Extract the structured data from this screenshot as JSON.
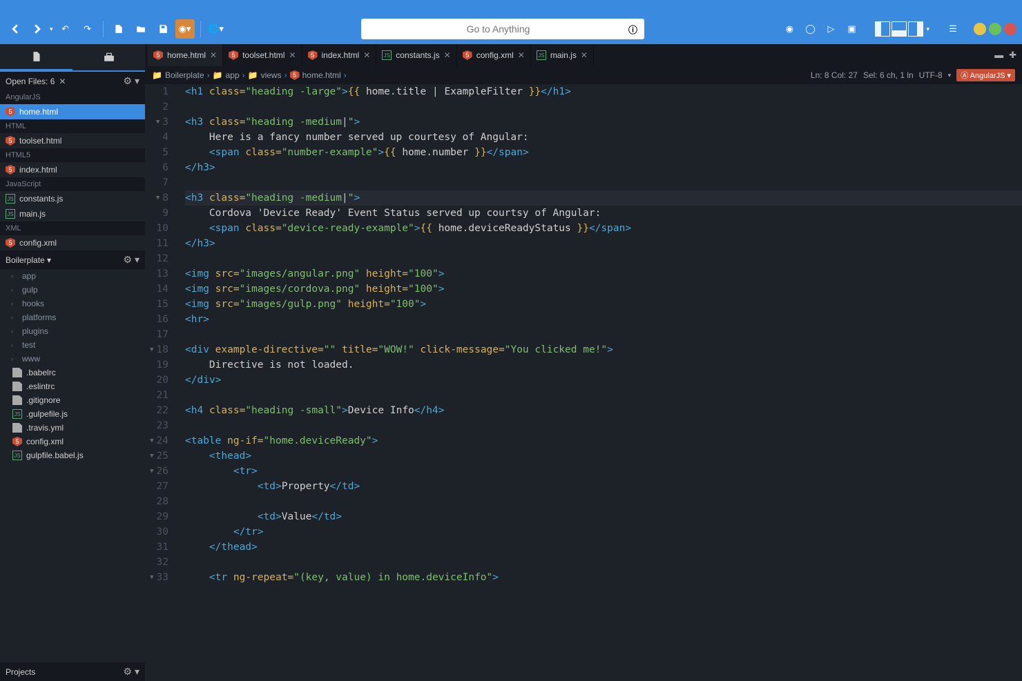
{
  "toolbar": {
    "search_placeholder": "Go to Anything"
  },
  "side": {
    "open_files": "Open Files: 6",
    "groups": [
      {
        "label": "AngularJS",
        "items": [
          {
            "name": "home.html",
            "sel": true,
            "ic": "red"
          }
        ]
      },
      {
        "label": "HTML",
        "items": [
          {
            "name": "toolset.html",
            "ic": "red"
          }
        ]
      },
      {
        "label": "HTML5",
        "items": [
          {
            "name": "index.html",
            "ic": "red"
          }
        ]
      },
      {
        "label": "JavaScript",
        "items": [
          {
            "name": "constants.js",
            "ic": "js"
          },
          {
            "name": "main.js",
            "ic": "js"
          }
        ]
      },
      {
        "label": "XML",
        "items": [
          {
            "name": "config.xml",
            "ic": "red"
          }
        ]
      }
    ],
    "project": "Boilerplate",
    "folders": [
      "app",
      "gulp",
      "hooks",
      "platforms",
      "plugins",
      "test",
      "www"
    ],
    "files": [
      ".babelrc",
      ".eslintrc",
      ".gitignore",
      ".gulpefile.js",
      ".travis.yml",
      "config.xml",
      "gulpfile.babel.js"
    ],
    "projects_label": "Projects"
  },
  "tabs": [
    {
      "name": "home.html",
      "ic": "red",
      "active": true
    },
    {
      "name": "toolset.html",
      "ic": "red"
    },
    {
      "name": "index.html",
      "ic": "red"
    },
    {
      "name": "constants.js",
      "ic": "js"
    },
    {
      "name": "config.xml",
      "ic": "red"
    },
    {
      "name": "main.js",
      "ic": "js"
    }
  ],
  "breadcrumb": [
    "Boilerplate",
    "app",
    "views",
    "home.html"
  ],
  "status": {
    "pos": "Ln: 8 Col: 27",
    "sel": "Sel: 6 ch, 1 ln",
    "enc": "UTF-8",
    "lang": "AngularJS"
  },
  "code": [
    {
      "n": 1,
      "h": "<span class='t-tag'>&lt;h1</span> <span class='t-attr'>class=</span><span class='t-str'>\"heading -large\"</span><span class='t-tag'>&gt;</span><span class='t-ang'>{{</span> <span class='t-txt'>home</span>.<span class='t-txt'>title</span> | <span class='t-txt'>ExampleFilter</span> <span class='t-ang'>}}</span><span class='t-tag'>&lt;/h1&gt;</span>"
    },
    {
      "n": 2,
      "h": ""
    },
    {
      "n": 3,
      "fold": true,
      "h": "<span class='t-tag'>&lt;h3</span> <span class='t-attr'>class=</span><span class='t-str'>\"heading -medium</span>|<span class='t-str'>\"</span><span class='t-tag'>&gt;</span>"
    },
    {
      "n": 4,
      "h": "    <span class='t-txt'>Here is a fancy number served up courtesy of Angular:</span>"
    },
    {
      "n": 5,
      "h": "    <span class='t-tag'>&lt;span</span> <span class='t-attr'>class=</span><span class='t-str'>\"number-example\"</span><span class='t-tag'>&gt;</span><span class='t-ang'>{{</span> <span class='t-txt'>home</span>.<span class='t-txt'>number</span> <span class='t-ang'>}}</span><span class='t-tag'>&lt;/span&gt;</span>"
    },
    {
      "n": 6,
      "h": "<span class='t-tag'>&lt;/h3&gt;</span>"
    },
    {
      "n": 7,
      "h": ""
    },
    {
      "n": 8,
      "fold": true,
      "hl": true,
      "h": "<span class='t-tag'>&lt;h3</span> <span class='t-attr'>class=</span><span class='t-str'>\"heading -medium</span>|<span class='t-str'>\"</span><span class='t-tag'>&gt;</span>"
    },
    {
      "n": 9,
      "h": "    <span class='t-txt'>Cordova 'Device Ready' Event Status served up courtsy of Angular:</span>"
    },
    {
      "n": 10,
      "h": "    <span class='t-tag'>&lt;span</span> <span class='t-attr'>class=</span><span class='t-str'>\"device-ready-example\"</span><span class='t-tag'>&gt;</span><span class='t-ang'>{{</span> <span class='t-txt'>home</span>.<span class='t-txt'>deviceReadyStatus</span> <span class='t-ang'>}}</span><span class='t-tag'>&lt;/span&gt;</span>"
    },
    {
      "n": 11,
      "h": "<span class='t-tag'>&lt;/h3&gt;</span>"
    },
    {
      "n": 12,
      "h": ""
    },
    {
      "n": 13,
      "h": "<span class='t-tag'>&lt;img</span> <span class='t-attr'>src=</span><span class='t-str'>\"images/angular.png\"</span> <span class='t-attr'>height=</span><span class='t-str'>\"100\"</span><span class='t-tag'>&gt;</span>"
    },
    {
      "n": 14,
      "h": "<span class='t-tag'>&lt;img</span> <span class='t-attr'>src=</span><span class='t-str'>\"images/cordova.png\"</span> <span class='t-attr'>height=</span><span class='t-str'>\"100\"</span><span class='t-tag'>&gt;</span>"
    },
    {
      "n": 15,
      "h": "<span class='t-tag'>&lt;img</span> <span class='t-attr'>src=</span><span class='t-str'>\"images/gulp.png\"</span> <span class='t-attr'>height=</span><span class='t-str'>\"100\"</span><span class='t-tag'>&gt;</span>"
    },
    {
      "n": 16,
      "h": "<span class='t-tag'>&lt;hr&gt;</span>"
    },
    {
      "n": 17,
      "h": ""
    },
    {
      "n": 18,
      "fold": true,
      "h": "<span class='t-tag'>&lt;div</span> <span class='t-attr'>example-directive=</span><span class='t-str'>\"\"</span> <span class='t-attr'>title=</span><span class='t-str'>\"WOW!\"</span> <span class='t-attr'>click-message=</span><span class='t-str'>\"You clicked me!\"</span><span class='t-tag'>&gt;</span>"
    },
    {
      "n": 19,
      "h": "    <span class='t-txt'>Directive is not loaded.</span>"
    },
    {
      "n": 20,
      "h": "<span class='t-tag'>&lt;/div&gt;</span>"
    },
    {
      "n": 21,
      "h": ""
    },
    {
      "n": 22,
      "h": "<span class='t-tag'>&lt;h4</span> <span class='t-attr'>class=</span><span class='t-str'>\"heading -small\"</span><span class='t-tag'>&gt;</span><span class='t-txt'>Device Info</span><span class='t-tag'>&lt;/h4&gt;</span>"
    },
    {
      "n": 23,
      "h": ""
    },
    {
      "n": 24,
      "fold": true,
      "h": "<span class='t-tag'>&lt;table</span> <span class='t-attr'>ng-if=</span><span class='t-str'>\"home.deviceReady\"</span><span class='t-tag'>&gt;</span>"
    },
    {
      "n": 25,
      "fold": true,
      "h": "    <span class='t-tag'>&lt;thead&gt;</span>"
    },
    {
      "n": 26,
      "fold": true,
      "h": "        <span class='t-tag'>&lt;tr&gt;</span>"
    },
    {
      "n": 27,
      "h": "            <span class='t-tag'>&lt;td&gt;</span><span class='t-txt'>Property</span><span class='t-tag'>&lt;/td&gt;</span>"
    },
    {
      "n": 28,
      "h": ""
    },
    {
      "n": 29,
      "h": "            <span class='t-tag'>&lt;td&gt;</span><span class='t-txt'>Value</span><span class='t-tag'>&lt;/td&gt;</span>"
    },
    {
      "n": 30,
      "h": "        <span class='t-tag'>&lt;/tr&gt;</span>"
    },
    {
      "n": 31,
      "h": "    <span class='t-tag'>&lt;/thead&gt;</span>"
    },
    {
      "n": 32,
      "h": ""
    },
    {
      "n": 33,
      "fold": true,
      "h": "    <span class='t-tag'>&lt;tr</span> <span class='t-attr'>ng-repeat=</span><span class='t-str'>\"(key, value) in home.deviceInfo\"</span><span class='t-tag'>&gt;</span>"
    }
  ]
}
